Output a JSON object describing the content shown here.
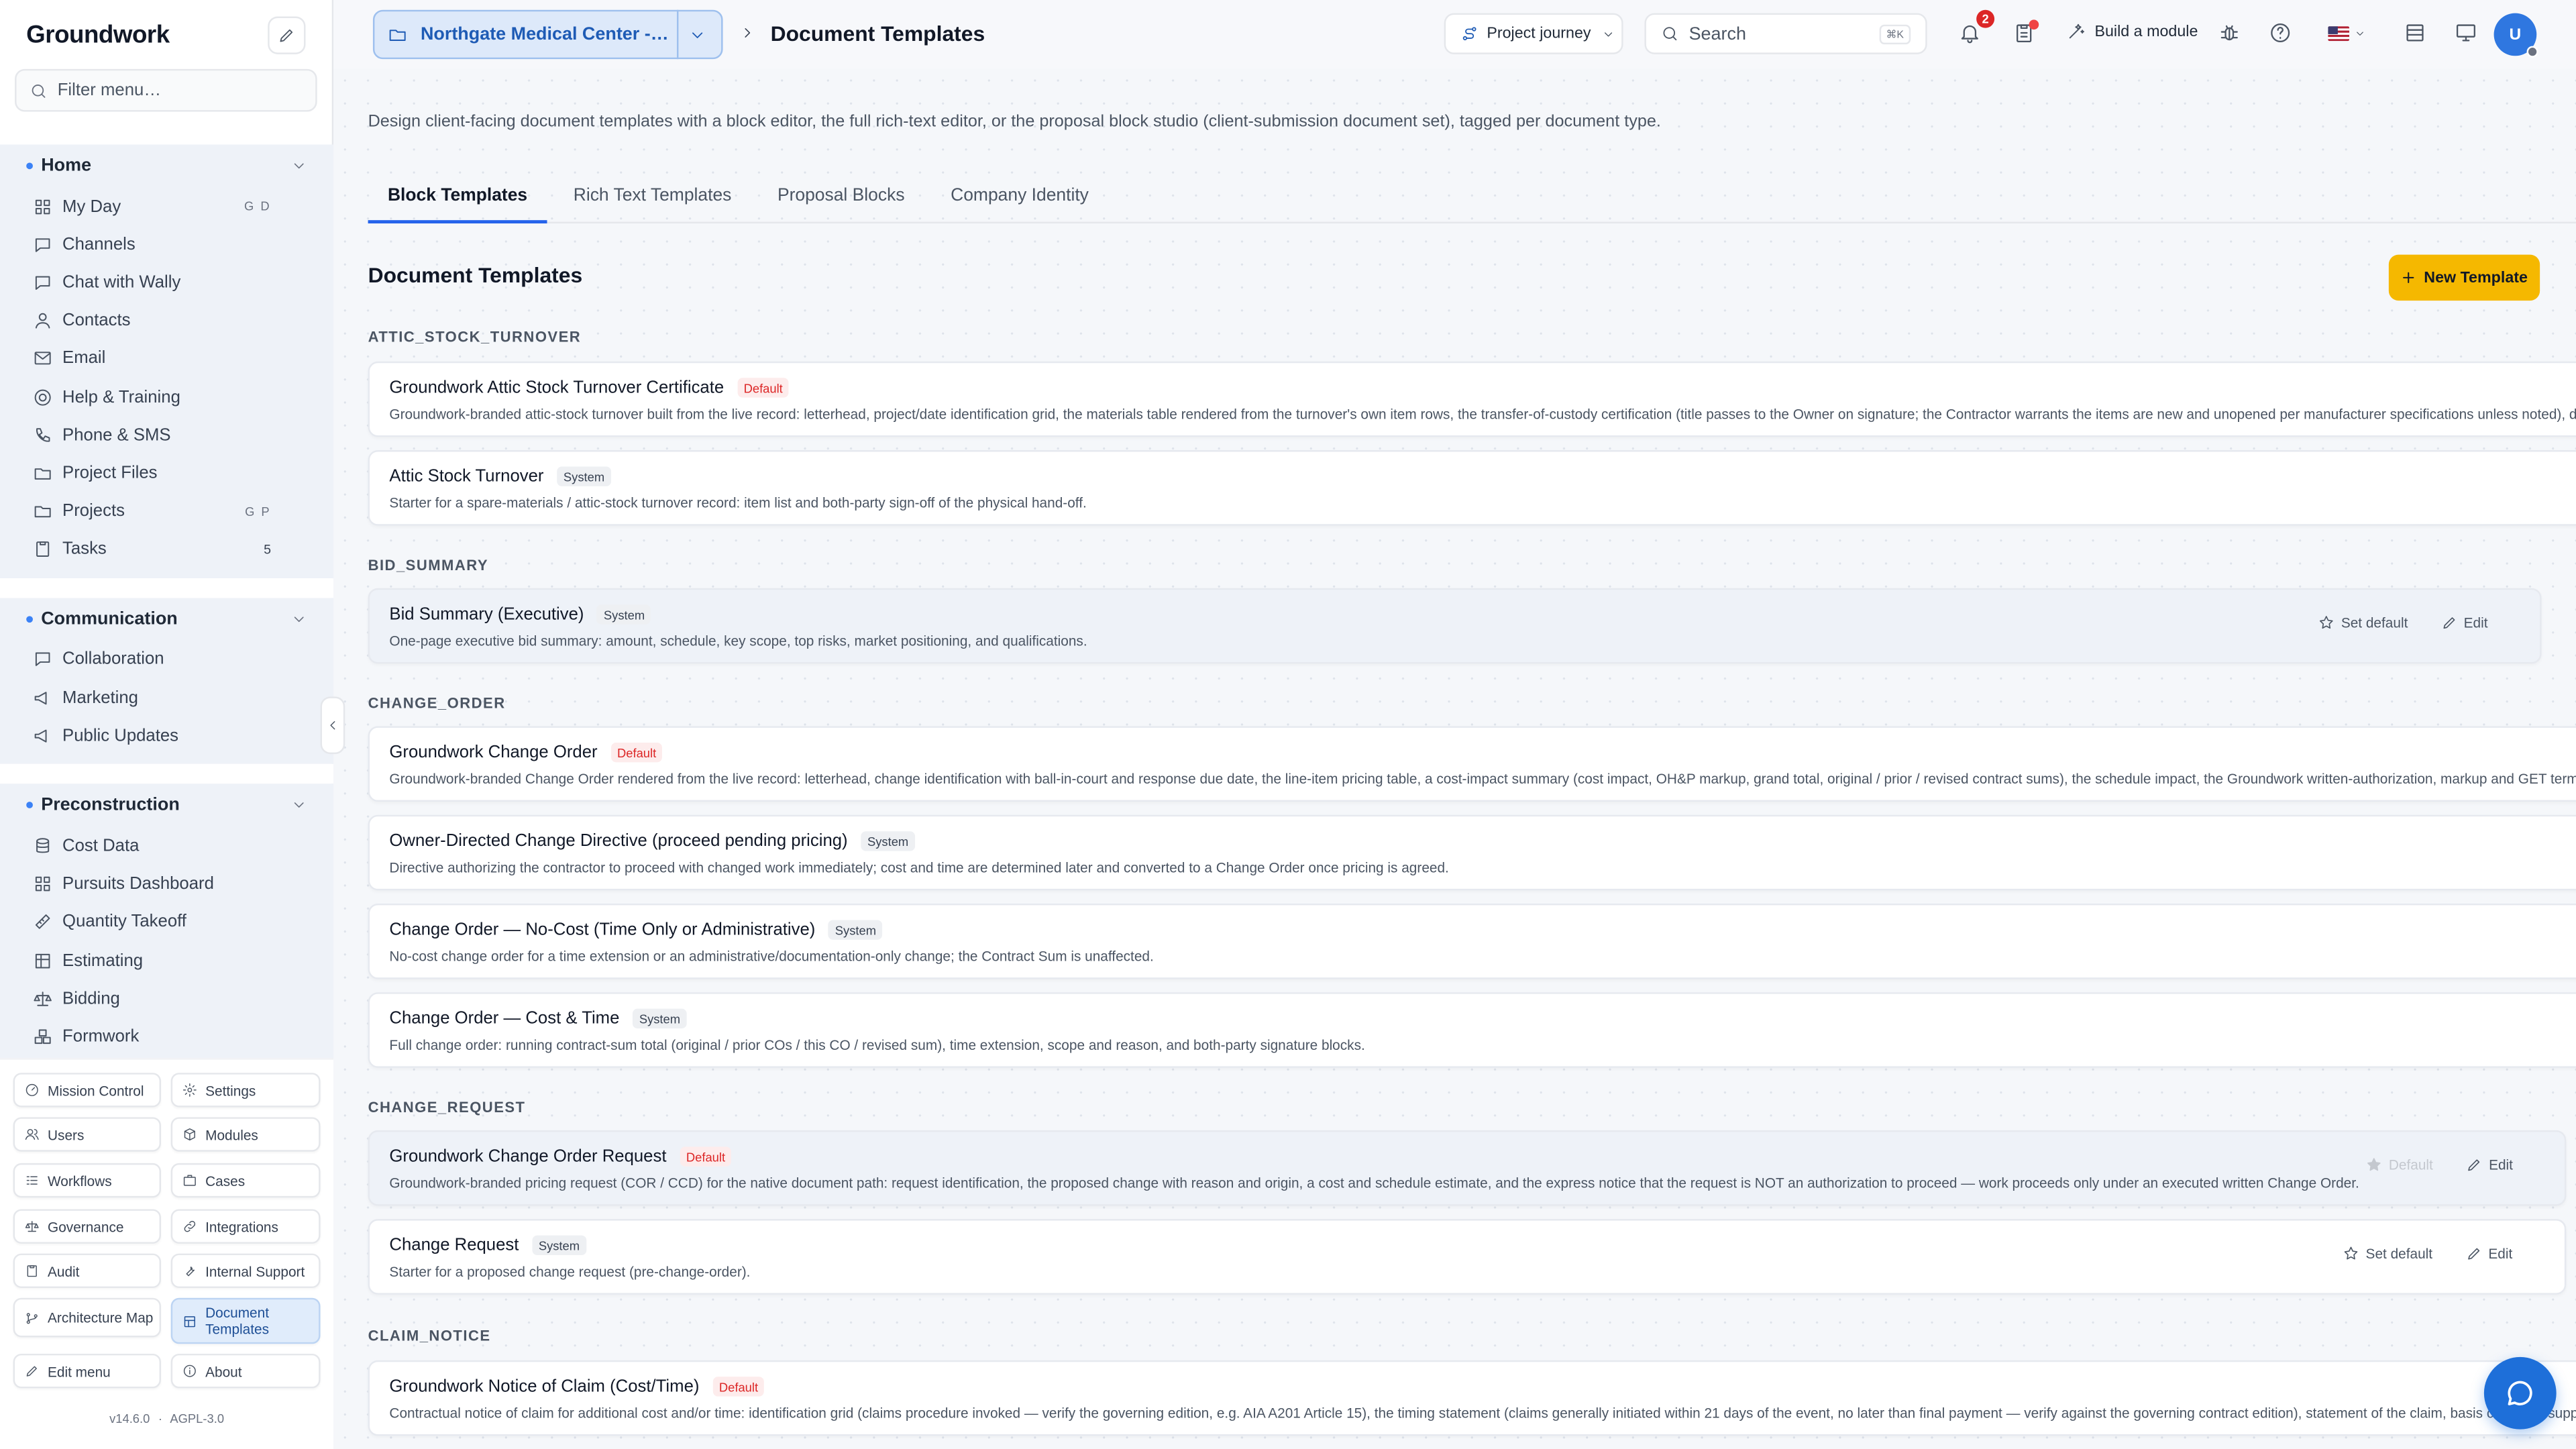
{
  "brand": "Groundwork",
  "sidebar": {
    "filter_placeholder": "Filter menu…",
    "sections": [
      {
        "title": "Home",
        "items": [
          {
            "label": "My Day",
            "kbd": "G D",
            "icon": "grid-icon"
          },
          {
            "label": "Channels",
            "icon": "chat-bubble-icon"
          },
          {
            "label": "Chat with Wally",
            "icon": "chat-bubble-icon"
          },
          {
            "label": "Contacts",
            "icon": "user-icon"
          },
          {
            "label": "Email",
            "icon": "mail-icon"
          },
          {
            "label": "Help & Training",
            "icon": "lifebuoy-icon"
          },
          {
            "label": "Phone & SMS",
            "icon": "phone-icon"
          },
          {
            "label": "Project Files",
            "icon": "folder-icon"
          },
          {
            "label": "Projects",
            "kbd": "G P",
            "icon": "folder-icon"
          },
          {
            "label": "Tasks",
            "count": "5",
            "icon": "clipboard-icon"
          }
        ]
      },
      {
        "title": "Communication",
        "items": [
          {
            "label": "Collaboration",
            "icon": "chat-bubble-icon"
          },
          {
            "label": "Marketing",
            "icon": "megaphone-icon"
          },
          {
            "label": "Public Updates",
            "icon": "megaphone-icon"
          }
        ]
      },
      {
        "title": "Preconstruction",
        "items": [
          {
            "label": "Cost Data",
            "icon": "database-icon"
          },
          {
            "label": "Pursuits Dashboard",
            "icon": "grid-icon"
          },
          {
            "label": "Quantity Takeoff",
            "icon": "ruler-icon"
          },
          {
            "label": "Estimating",
            "icon": "table-icon"
          },
          {
            "label": "Bidding",
            "icon": "scale-icon"
          },
          {
            "label": "Formwork",
            "icon": "boxes-icon"
          }
        ]
      }
    ],
    "quick": [
      {
        "label": "Mission Control",
        "icon": "gauge-icon"
      },
      {
        "label": "Settings",
        "icon": "gear-icon"
      },
      {
        "label": "Users",
        "icon": "users-icon"
      },
      {
        "label": "Modules",
        "icon": "package-icon"
      },
      {
        "label": "Workflows",
        "icon": "list-icon"
      },
      {
        "label": "Cases",
        "icon": "briefcase-icon"
      },
      {
        "label": "Governance",
        "icon": "scale-icon"
      },
      {
        "label": "Integrations",
        "icon": "link-icon"
      },
      {
        "label": "Audit",
        "icon": "clipboard-icon"
      },
      {
        "label": "Internal Support",
        "icon": "wrench-icon"
      },
      {
        "label": "Architecture Map",
        "icon": "git-icon"
      },
      {
        "label": "Document Templates",
        "icon": "layout-icon"
      },
      {
        "label": "Edit menu",
        "icon": "pencil-icon"
      },
      {
        "label": "About",
        "icon": "info-icon"
      }
    ],
    "version": "v14.6.0",
    "version_sep": "·",
    "license": "AGPL-3.0"
  },
  "topbar": {
    "project": "Northgate Medical Center - Building B Expansion",
    "title": "Document Templates",
    "journey": "Project journey",
    "search_placeholder": "Search",
    "search_kbd": "⌘K",
    "notif_count": "2",
    "build": "Build a module",
    "avatar": "U"
  },
  "main": {
    "description": "Design client-facing document templates with a block editor, the full rich-text editor, or the proposal block studio (client-submission document set), tagged per document type.",
    "tabs": [
      "Block Templates",
      "Rich Text Templates",
      "Proposal Blocks",
      "Company Identity"
    ],
    "heading": "Document Templates",
    "new_button": "New Template",
    "groups": [
      {
        "name": "ATTIC_STOCK_TURNOVER",
        "templates": [
          {
            "title": "Groundwork Attic Stock Turnover Certificate",
            "tag": "Default",
            "desc": "Groundwork-branded attic-stock turnover built from the live record: letterhead, project/date identification grid, the materials table rendered from the turnover's own item rows, the transfer-of-custody certification (title passes to the Owner on signature; the Contractor warrants the items are new and unopened per manufacturer specifications unless noted), dual co"
          },
          {
            "title": "Attic Stock Turnover",
            "tag": "System",
            "desc": "Starter for a spare-materials / attic-stock turnover record: item list and both-party sign-off of the physical hand-off."
          }
        ]
      },
      {
        "name": "BID_SUMMARY",
        "templates": [
          {
            "title": "Bid Summary (Executive)",
            "tag": "System",
            "desc": "One-page executive bid summary: amount, schedule, key scope, top risks, market positioning, and qualifications.",
            "set_default": "Set default",
            "edit": "Edit"
          }
        ]
      },
      {
        "name": "CHANGE_ORDER",
        "templates": [
          {
            "title": "Groundwork Change Order",
            "tag": "Default",
            "desc": "Groundwork-branded Change Order rendered from the live record: letterhead, change identification with ball-in-court and response due date, the line-item pricing table, a cost-impact summary (cost impact, OH&P markup, grand total, original / prior / revised contract sums), the schedule impact, the Groundwork written-authorization, markup and GET terms, an"
          },
          {
            "title": "Owner-Directed Change Directive (proceed pending pricing)",
            "tag": "System",
            "desc": "Directive authorizing the contractor to proceed with changed work immediately; cost and time are determined later and converted to a Change Order once pricing is agreed."
          },
          {
            "title": "Change Order — No-Cost (Time Only or Administrative)",
            "tag": "System",
            "desc": "No-cost change order for a time extension or an administrative/documentation-only change; the Contract Sum is unaffected."
          },
          {
            "title": "Change Order — Cost & Time",
            "tag": "System",
            "desc": "Full change order: running contract-sum total (original / prior COs / this CO / revised sum), time extension, scope and reason, and both-party signature blocks."
          }
        ]
      },
      {
        "name": "CHANGE_REQUEST",
        "templates": [
          {
            "title": "Groundwork Change Order Request",
            "tag": "Default",
            "desc": "Groundwork-branded pricing request (COR / CCD) for the native document path: request identification, the proposed change with reason and origin, a cost and schedule estimate, and the express notice that the request is NOT an authorization to proceed — work proceeds only under an executed written Change Order.",
            "set_default": "Default",
            "edit": "Edit"
          },
          {
            "title": "Change Request",
            "tag": "System",
            "desc": "Starter for a proposed change request (pre-change-order).",
            "set_default": "Set default",
            "edit": "Edit"
          }
        ]
      },
      {
        "name": "CLAIM_NOTICE",
        "templates": [
          {
            "title": "Groundwork Notice of Claim (Cost/Time)",
            "tag": "Default",
            "desc": "Contractual notice of claim for additional cost and/or time: identification grid (claims procedure invoked — verify the governing edition, e.g. AIA A201 Article 15), the timing statement (claims generally initiated within 21 days of the event, no later than final payment — verify against the governing contract edition), statement of the claim, basis checklist, supporting"
          }
        ]
      }
    ]
  },
  "colors": {
    "accent": "#2563eb",
    "primary_button": "#f5b800",
    "default_tag": "#dc2626",
    "badge": "#dc2626"
  }
}
